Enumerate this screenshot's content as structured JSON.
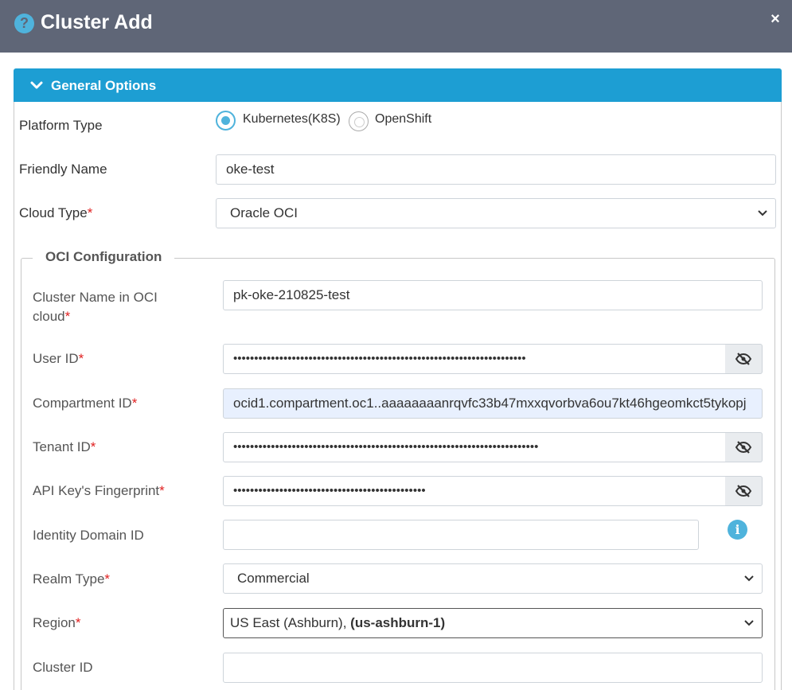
{
  "dialog": {
    "title": "Cluster Add",
    "close_glyph": "×",
    "help_glyph": "?"
  },
  "section": {
    "title": "General Options"
  },
  "platform": {
    "label": "Platform Type",
    "options": [
      {
        "label": "Kubernetes(K8S)",
        "selected": true
      },
      {
        "label": "OpenShift",
        "selected": false
      }
    ]
  },
  "friendly_name": {
    "label": "Friendly Name",
    "value": "oke-test"
  },
  "cloud_type": {
    "label": "Cloud Type",
    "required": "*",
    "value": "Oracle OCI"
  },
  "oci": {
    "legend": "OCI Configuration",
    "cluster_name": {
      "label_line1": "Cluster Name in OCI",
      "label_line2": "cloud",
      "required": "*",
      "value": "pk-oke-210825-test"
    },
    "user_id": {
      "label": "User ID",
      "required": "*",
      "value": "••••••••••••••••••••••••••••••••••••••••••••••••••••••••••••••••••••••"
    },
    "compartment_id": {
      "label": "Compartment ID",
      "required": "*",
      "value": "ocid1.compartment.oc1..aaaaaaaanrqvfc33b47mxxqvorbva6ou7kt46hgeomkct5tykopj"
    },
    "tenant_id": {
      "label": "Tenant ID",
      "required": "*",
      "value": "•••••••••••••••••••••••••••••••••••••••••••••••••••••••••••••••••••••••••"
    },
    "fingerprint": {
      "label": "API Key's Fingerprint",
      "required": "*",
      "value": "••••••••••••••••••••••••••••••••••••••••••••••"
    },
    "identity_domain": {
      "label": "Identity Domain ID",
      "value": "",
      "info_glyph": "i"
    },
    "realm_type": {
      "label": "Realm Type",
      "required": "*",
      "value": "Commercial"
    },
    "region": {
      "label": "Region",
      "required": "*",
      "value_plain": "US East (Ashburn), ",
      "value_bold": "(us-ashburn-1)"
    },
    "cluster_id": {
      "label": "Cluster ID",
      "value": ""
    }
  },
  "colors": {
    "titlebar": "#5f6677",
    "accent": "#1d9ed3",
    "info": "#4fb3dc",
    "required": "#e02020"
  },
  "icons": [
    "help-icon",
    "close-icon",
    "chevron-down-icon",
    "eye-slash-icon",
    "info-icon"
  ]
}
